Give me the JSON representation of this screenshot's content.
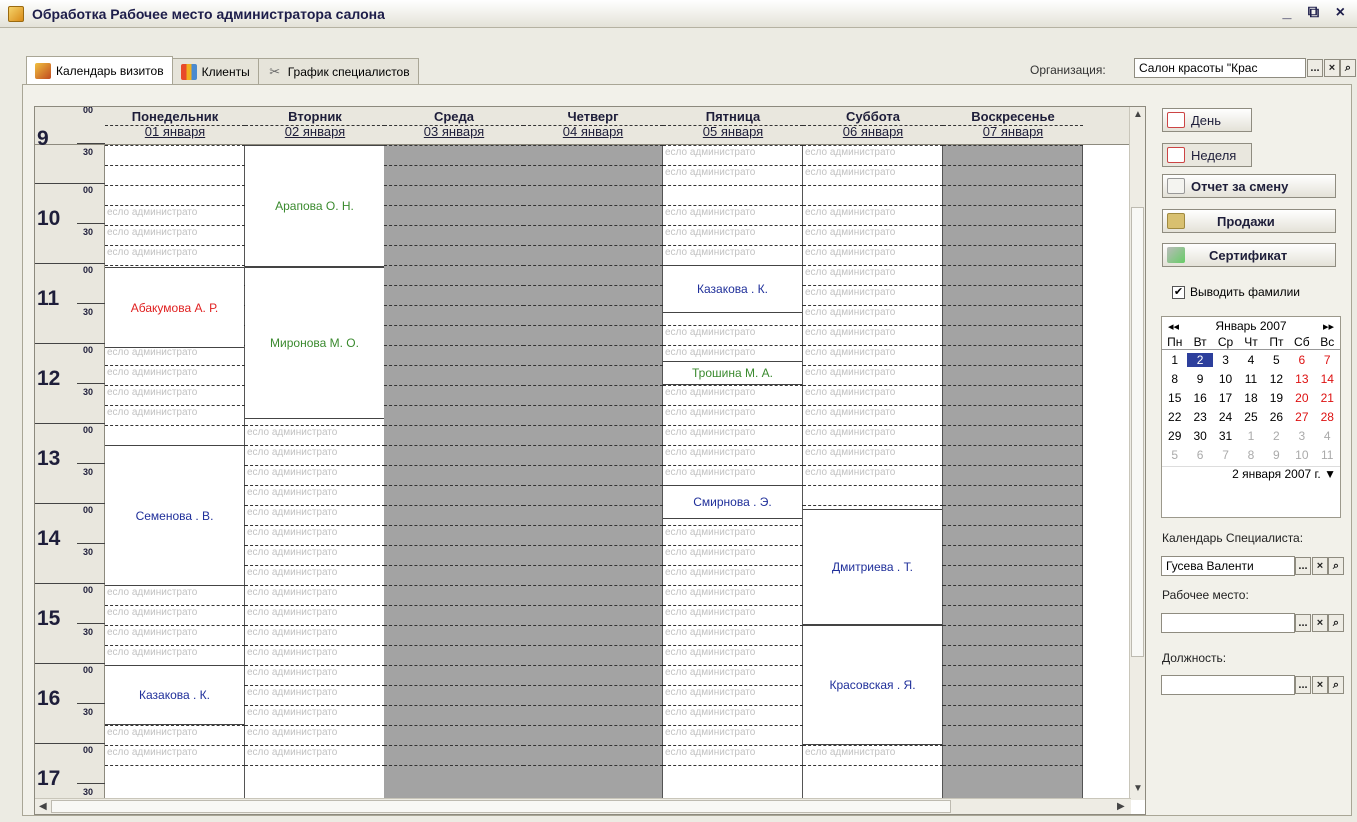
{
  "window": {
    "title": "Обработка  Рабочее место администратора салона",
    "controls": "_ ⧉ ×"
  },
  "tabs": [
    {
      "label": "Календарь визитов",
      "active": true,
      "icon": "calendar-icon"
    },
    {
      "label": "Клиенты",
      "active": false,
      "icon": "clients-icon"
    },
    {
      "label": "График специалистов",
      "active": false,
      "icon": "scissors-icon"
    }
  ],
  "organization": {
    "label": "Организация:",
    "value": "Салон красоты \"Крас"
  },
  "days": [
    {
      "name": "Понедельник",
      "date": "01 января"
    },
    {
      "name": "Вторник",
      "date": "02 января"
    },
    {
      "name": "Среда",
      "date": "03 января"
    },
    {
      "name": "Четверг",
      "date": "04 января"
    },
    {
      "name": "Пятница",
      "date": "05 января"
    },
    {
      "name": "Суббота",
      "date": "06 января"
    },
    {
      "name": "Воскресенье",
      "date": "07 января"
    }
  ],
  "hours": [
    "9",
    "10",
    "11",
    "12",
    "13",
    "14",
    "15",
    "16",
    "17"
  ],
  "minutes": {
    "zero": "00",
    "half": "30"
  },
  "ghost_text": "есло администрато",
  "appointments": [
    {
      "name": "Арапова О. Н.",
      "color": "#3a8a2e"
    },
    {
      "name": "Абакумова А. Р.",
      "color": "#e02020"
    },
    {
      "name": "Миронова М. О.",
      "color": "#3a8a2e"
    },
    {
      "name": "Казакова . К.",
      "color": "#1f2f9a"
    },
    {
      "name": "Трошина М. А.",
      "color": "#3a8a2e"
    },
    {
      "name": "Семенова . В.",
      "color": "#1f2f9a"
    },
    {
      "name": "Смирнова . Э.",
      "color": "#1f2f9a"
    },
    {
      "name": "Дмитриева . Т.",
      "color": "#1f2f9a"
    },
    {
      "name": "Казакова . К.",
      "color": "#1f2f9a"
    },
    {
      "name": "Красовская . Я.",
      "color": "#1f2f9a"
    }
  ],
  "side": {
    "day_button": "День",
    "week_button": "Неделя",
    "shift_report_button": "Отчет за смену",
    "sales_button": "Продажи",
    "certificate_button": "Сертификат",
    "show_surnames": {
      "label": "Выводить фамилии",
      "checked": true
    }
  },
  "mini_calendar": {
    "month": "Январь 2007",
    "prev": "◂◂",
    "next": "▸▸",
    "weekdays": [
      "Пн",
      "Вт",
      "Ср",
      "Чт",
      "Пт",
      "Сб",
      "Вс"
    ],
    "weeks": [
      [
        "1",
        "2",
        "3",
        "4",
        "5",
        "6",
        "7"
      ],
      [
        "8",
        "9",
        "10",
        "11",
        "12",
        "13",
        "14"
      ],
      [
        "15",
        "16",
        "17",
        "18",
        "19",
        "20",
        "21"
      ],
      [
        "22",
        "23",
        "24",
        "25",
        "26",
        "27",
        "28"
      ],
      [
        "29",
        "30",
        "31",
        "1",
        "2",
        "3",
        "4"
      ],
      [
        "5",
        "6",
        "7",
        "8",
        "9",
        "10",
        "11"
      ]
    ],
    "selected_label": "2 января 2007 г."
  },
  "specialist": {
    "label": "Календарь Специалиста:",
    "value": "Гусева Валенти"
  },
  "workplace": {
    "label": "Рабочее место:",
    "value": ""
  },
  "position": {
    "label": "Должность:",
    "value": ""
  },
  "field_buttons": {
    "choose": "...",
    "clear": "×",
    "open": "🔍"
  }
}
